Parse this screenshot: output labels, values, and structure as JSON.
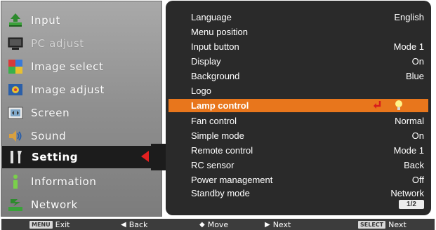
{
  "menu": {
    "items": [
      {
        "label": "Input",
        "icon": "input-icon"
      },
      {
        "label": "PC adjust",
        "icon": "pc-adjust-icon"
      },
      {
        "label": "Image select",
        "icon": "image-select-icon"
      },
      {
        "label": "Image adjust",
        "icon": "image-adjust-icon"
      },
      {
        "label": "Screen",
        "icon": "screen-icon"
      },
      {
        "label": "Sound",
        "icon": "sound-icon"
      },
      {
        "label": "Setting",
        "icon": "setting-icon"
      },
      {
        "label": "Information",
        "icon": "information-icon"
      },
      {
        "label": "Network",
        "icon": "network-icon"
      }
    ],
    "selected": "Setting"
  },
  "settings": {
    "rows": [
      {
        "name": "Language",
        "value": "English"
      },
      {
        "name": "Menu position",
        "value": ""
      },
      {
        "name": "Input button",
        "value": "Mode 1"
      },
      {
        "name": "Display",
        "value": "On"
      },
      {
        "name": "Background",
        "value": "Blue"
      },
      {
        "name": "Logo",
        "value": ""
      },
      {
        "name": "Lamp control",
        "value": ""
      },
      {
        "name": "Fan control",
        "value": "Normal"
      },
      {
        "name": "Simple mode",
        "value": "On"
      },
      {
        "name": "Remote control",
        "value": "Mode 1"
      },
      {
        "name": "RC sensor",
        "value": "Back"
      },
      {
        "name": "Power management",
        "value": "Off"
      },
      {
        "name": "Standby mode",
        "value": "Network"
      }
    ],
    "highlighted": "Lamp control",
    "page": "1/2"
  },
  "navbar": {
    "exit_key": "MENU",
    "exit_label": "Exit",
    "back_label": "Back",
    "move_label": "Move",
    "next_label": "Next",
    "select_key": "SELECT",
    "select_label": "Next"
  },
  "colors": {
    "highlight": "#e8761c",
    "selected_arrow": "#e32020",
    "panel": "#2a2a2a"
  }
}
